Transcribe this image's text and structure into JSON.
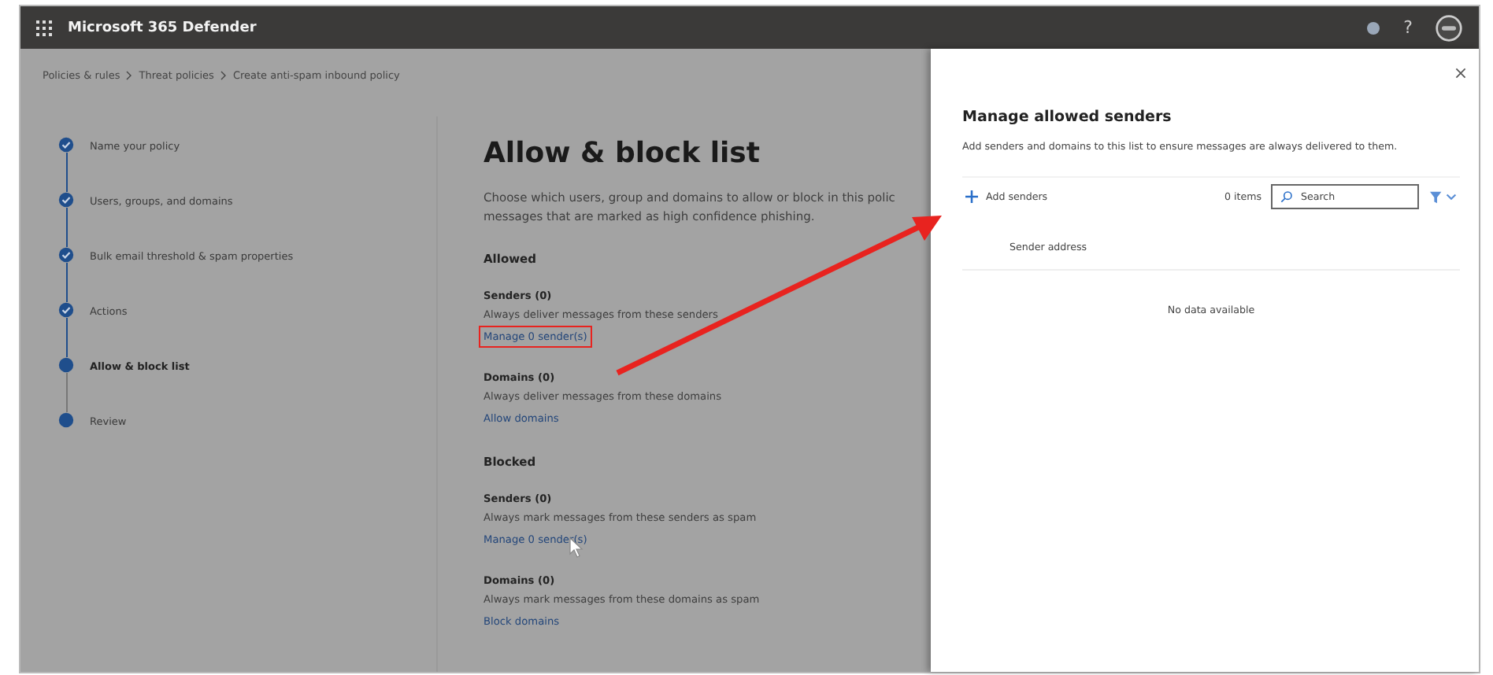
{
  "app_bar": {
    "title": "Microsoft 365 Defender",
    "help": "?"
  },
  "breadcrumb": [
    "Policies & rules",
    "Threat policies",
    "Create anti-spam inbound policy"
  ],
  "steps": [
    {
      "label": "Name your policy",
      "completed": true,
      "selected": false
    },
    {
      "label": "Users, groups, and domains",
      "completed": true,
      "selected": false
    },
    {
      "label": "Bulk email threshold & spam properties",
      "completed": true,
      "selected": false
    },
    {
      "label": "Actions",
      "completed": true,
      "selected": false
    },
    {
      "label": "Allow & block list",
      "completed": false,
      "selected": true
    },
    {
      "label": "Review",
      "completed": false,
      "selected": false
    }
  ],
  "main": {
    "title": "Allow & block list",
    "description": "Choose which users, group and domains to allow or block in this polic\nmessages that are marked as high confidence phishing.",
    "groups": [
      {
        "heading": "Allowed",
        "items": [
          {
            "title": "Senders (0)",
            "description": "Always deliver messages from these senders",
            "link": "Manage 0 sender(s)",
            "highlighted": true
          },
          {
            "title": "Domains (0)",
            "description": "Always deliver messages from these domains",
            "link": "Allow domains",
            "highlighted": false
          }
        ]
      },
      {
        "heading": "Blocked",
        "items": [
          {
            "title": "Senders (0)",
            "description": "Always mark messages from these senders as spam",
            "link": "Manage 0 sender(s)",
            "highlighted": false
          },
          {
            "title": "Domains (0)",
            "description": "Always mark messages from these domains as spam",
            "link": "Block domains",
            "highlighted": false
          }
        ]
      }
    ]
  },
  "panel": {
    "title": "Manage allowed senders",
    "description": "Add senders and domains to this list to ensure messages are always delivered to them.",
    "add_button": "Add senders",
    "count": "0 items",
    "search": {
      "placeholder": "Search"
    },
    "columns": [
      "Sender address"
    ],
    "empty_message": "No data available"
  }
}
